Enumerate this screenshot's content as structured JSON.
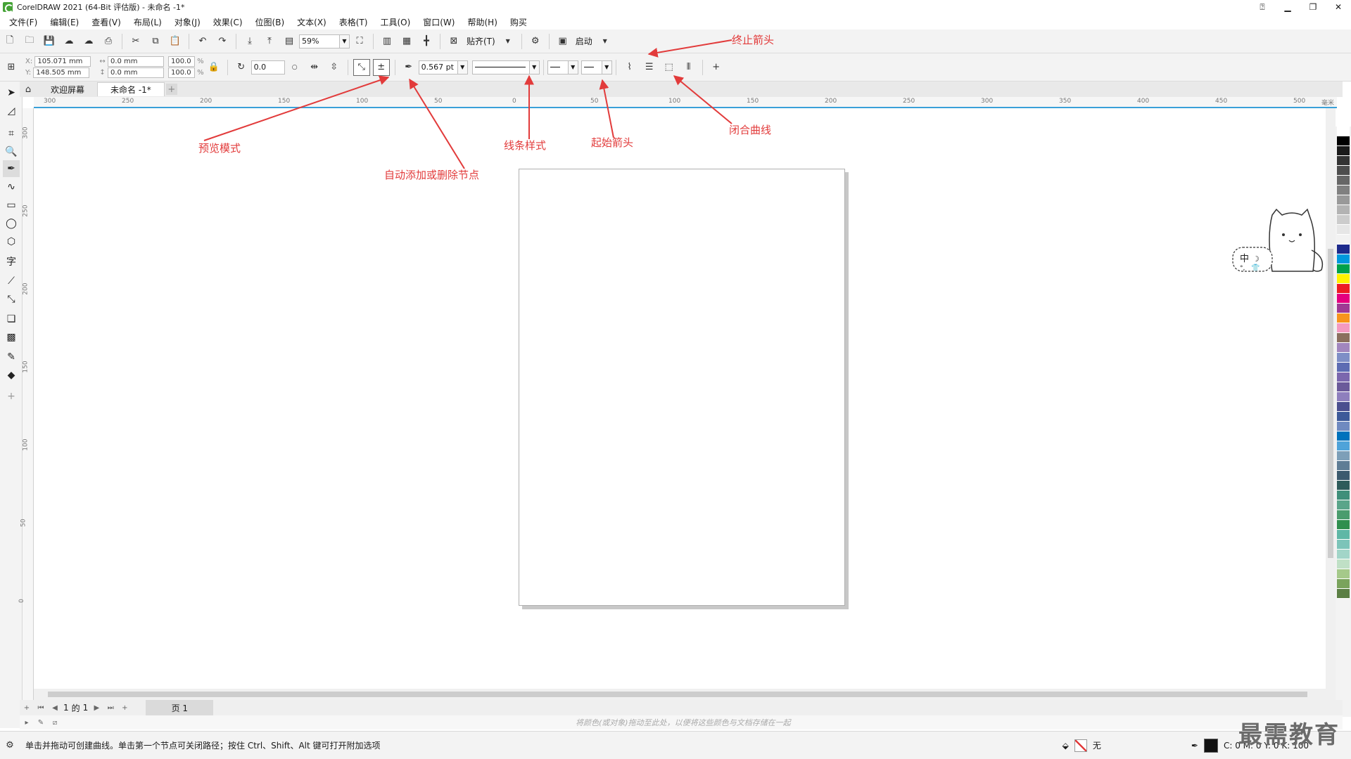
{
  "window": {
    "title": "CorelDRAW 2021 (64-Bit 评估版) - 未命名 -1*"
  },
  "menu": [
    "文件(F)",
    "编辑(E)",
    "查看(V)",
    "布局(L)",
    "对象(J)",
    "效果(C)",
    "位图(B)",
    "文本(X)",
    "表格(T)",
    "工具(O)",
    "窗口(W)",
    "帮助(H)",
    "购买"
  ],
  "std_toolbar": {
    "zoom_value": "59%",
    "snap_label": "贴齐(T)",
    "launch_label": "启动"
  },
  "prop_toolbar": {
    "x_value": "105.071 mm",
    "y_value": "148.505 mm",
    "w_value": "0.0 mm",
    "h_value": "0.0 mm",
    "scale_x": "100.0",
    "scale_y": "100.0",
    "rotation": "0.0",
    "outline_width": "0.567 pt"
  },
  "tabs": [
    {
      "label": "欢迎屏幕"
    },
    {
      "label": "未命名 -1*"
    }
  ],
  "ruler": {
    "h_labels": [
      "300",
      "250",
      "200",
      "150",
      "100",
      "50",
      "0",
      "50",
      "100",
      "150",
      "200",
      "250",
      "300",
      "350",
      "400",
      "450",
      "500"
    ],
    "h_unit": "毫米",
    "v_labels": [
      "300",
      "250",
      "200",
      "150",
      "100",
      "50",
      "0"
    ]
  },
  "page_nav": {
    "page_index": "1",
    "of_label": "的",
    "page_total": "1",
    "page_tab": "页 1"
  },
  "dock_hint": "将颜色(或对象)拖动至此处，以便将这些颜色与文档存储在一起",
  "status": {
    "message": "单击并拖动可创建曲线。单击第一个节点可关闭路径；按住 Ctrl、Shift、Alt 键可打开附加选项",
    "fill_label": "无",
    "cmyk": "C: 0 M: 0 Y: 0 K: 100"
  },
  "annotations": {
    "end_arrow": "终止箭头",
    "preview_mode": "预览模式",
    "auto_add_delete": "自动添加或删除节点",
    "line_style": "线条样式",
    "start_arrow": "起始箭头",
    "close_curve": "闭合曲线"
  },
  "mascot": {
    "text": "中"
  },
  "watermark": "最需教育",
  "palette_colors": [
    "#ffffff",
    "#000000",
    "#1a1a1a",
    "#333333",
    "#4d4d4d",
    "#666666",
    "#808080",
    "#999999",
    "#b3b3b3",
    "#cccccc",
    "#e6e6e6",
    "#f2f2f2",
    "#1d2a8c",
    "#0098dd",
    "#00a14b",
    "#fff200",
    "#ed1c24",
    "#e4007f",
    "#9e3a94",
    "#f7941d",
    "#f49ac1",
    "#8b6f5e",
    "#a186be",
    "#7e8ec6",
    "#5d6cb3",
    "#7b67ae",
    "#6b5a9a",
    "#8e7fbd",
    "#4b4f8f",
    "#3d5a99",
    "#6f8ac0",
    "#0072bc",
    "#4fa3d9",
    "#7d9fb8",
    "#5f7d95",
    "#3c5a6e",
    "#2e5b5a",
    "#3f8f7a",
    "#5aa58a",
    "#4a9c6d",
    "#2f8f4e",
    "#5fb7a6",
    "#7cc4b9",
    "#a2d5c8",
    "#c0e0c6",
    "#a5c98a",
    "#7aa35c",
    "#5b7f44"
  ]
}
